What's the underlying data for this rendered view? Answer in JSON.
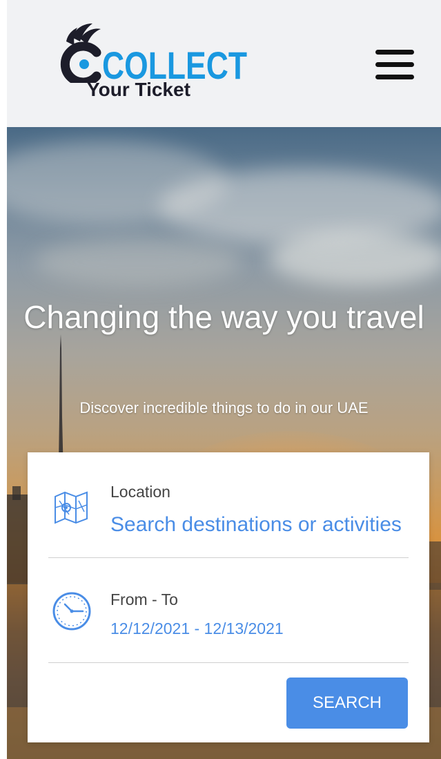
{
  "header": {
    "logo_main": "COLLECT",
    "logo_sub": "Your Ticket",
    "colors": {
      "logo_blue": "#1a98e0",
      "logo_dark": "#1d1d2a"
    }
  },
  "hero": {
    "title": "Changing the way you travel",
    "subtitle": "Discover incredible things to do in our UAE"
  },
  "search": {
    "location": {
      "label": "Location",
      "placeholder": "Search destinations or activities",
      "icon": "map-icon"
    },
    "dates": {
      "label": "From - To",
      "value": "12/12/2021 - 12/13/2021",
      "icon": "clock-icon"
    },
    "button_label": "SEARCH",
    "accent_color": "#4a8de6"
  }
}
